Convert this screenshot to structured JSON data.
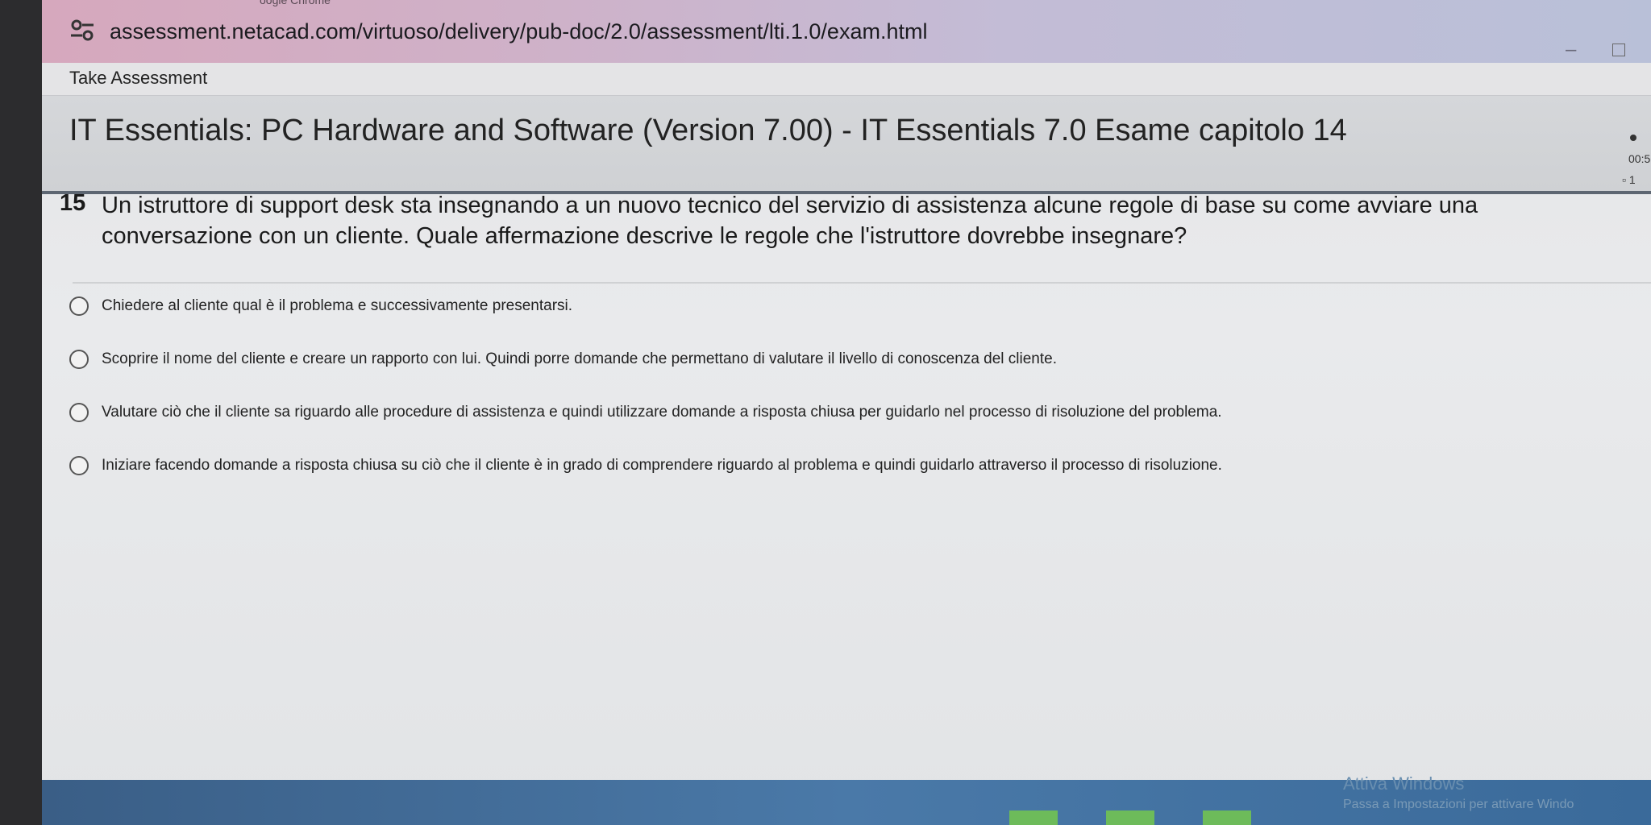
{
  "browser": {
    "title_fragment": "oogle Chrome",
    "url": "assessment.netacad.com/virtuoso/delivery/pub-doc/2.0/assessment/lti.1.0/exam.html",
    "site_icon": "key-settings-icon",
    "minimize_icon": "minimize-icon",
    "maximize_icon": "maximize-icon"
  },
  "page": {
    "take_assessment": "Take Assessment",
    "exam_title": "IT Essentials: PC Hardware and Software (Version 7.00) - IT Essentials 7.0 Esame capitolo 14",
    "timer": "00:5",
    "question_counter": "1"
  },
  "question": {
    "number": "15",
    "text": "Un istruttore di support desk sta insegnando a un nuovo tecnico del servizio di assistenza alcune regole di base su come avviare una conversazione con un cliente. Quale affermazione descrive le regole che l'istruttore dovrebbe insegnare?",
    "options": [
      {
        "label": "Chiedere al cliente qual è il problema e successivamente presentarsi."
      },
      {
        "label": "Scoprire il nome del cliente e creare un rapporto con lui. Quindi porre domande che permettano di valutare il livello di conoscenza del cliente."
      },
      {
        "label": "Valutare ciò che il cliente sa riguardo alle procedure di assistenza e quindi utilizzare domande a risposta chiusa per guidarlo nel processo di risoluzione del problema."
      },
      {
        "label": "Iniziare facendo domande a risposta chiusa su ciò che il cliente è in grado di comprendere riguardo al problema e quindi guidarlo attraverso il processo di risoluzione."
      }
    ]
  },
  "watermark": {
    "title": "Attiva Windows",
    "subtitle": "Passa a Impostazioni per attivare Windo"
  },
  "colors": {
    "titlebar_start": "#d6a8bd",
    "titlebar_end": "#b9c0d8",
    "header_rule": "#5d6672",
    "taskbar": "#4a79a8"
  }
}
